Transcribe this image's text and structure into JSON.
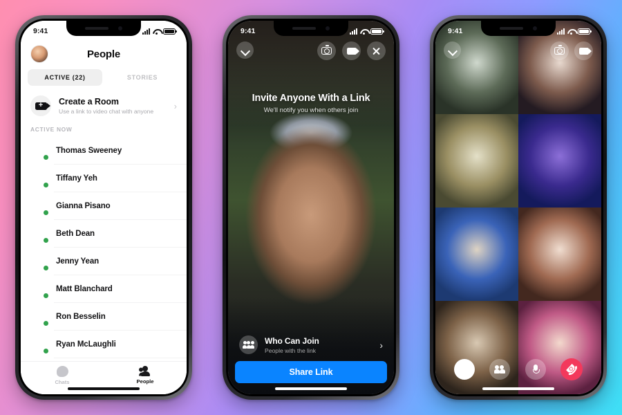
{
  "background": {
    "gradient_from": "#ff8fb0",
    "gradient_mid": "#a98cf5",
    "gradient_to": "#3ee0f5"
  },
  "phone1": {
    "status": {
      "time": "9:41",
      "signal_icon": "signal-bars-icon",
      "wifi_icon": "wifi-icon",
      "battery_icon": "battery-icon"
    },
    "header": {
      "title": "People",
      "avatar_icon": "profile-avatar"
    },
    "tabs": [
      {
        "label": "ACTIVE (22)",
        "active": true
      },
      {
        "label": "STORIES",
        "active": false
      }
    ],
    "create_room": {
      "title": "Create a Room",
      "subtitle": "Use a link to video chat with anyone",
      "icon": "add-video-room-icon",
      "chevron": "›"
    },
    "section_header": "ACTIVE NOW",
    "people": [
      {
        "name": "Thomas Sweeney",
        "online": true,
        "c1": "#8aa4c8",
        "c2": "#2c3f5c"
      },
      {
        "name": "Tiffany Yeh",
        "online": true,
        "c1": "#f3c43c",
        "c2": "#b07c1a"
      },
      {
        "name": "Gianna Pisano",
        "online": true,
        "c1": "#f0d7bb",
        "c2": "#b78a64"
      },
      {
        "name": "Beth Dean",
        "online": true,
        "c1": "#7e9b63",
        "c2": "#2f3a25"
      },
      {
        "name": "Jenny Yean",
        "online": true,
        "c1": "#e0a88a",
        "c2": "#8a4f3a"
      },
      {
        "name": "Matt Blanchard",
        "online": true,
        "c1": "#c3ccd8",
        "c2": "#3d5670"
      },
      {
        "name": "Ron Besselin",
        "online": true,
        "c1": "#79a6d8",
        "c2": "#26435f"
      },
      {
        "name": "Ryan McLaughli",
        "online": true,
        "c1": "#d7b27c",
        "c2": "#6d4f2e"
      }
    ],
    "tabbar": [
      {
        "label": "Chats",
        "icon": "chats-icon",
        "active": false
      },
      {
        "label": "People",
        "icon": "people-icon",
        "active": true
      }
    ]
  },
  "phone2": {
    "status": {
      "time": "9:41"
    },
    "top_controls": [
      {
        "name": "minimize-chevron-down-button",
        "icon": "chevron-down-icon"
      },
      {
        "name": "flip-camera-button",
        "icon": "camera-flip-icon"
      },
      {
        "name": "toggle-video-button",
        "icon": "video-camera-icon"
      },
      {
        "name": "close-call-button",
        "icon": "close-x-icon"
      }
    ],
    "invite": {
      "title": "Invite Anyone With a Link",
      "subtitle": "We'll notify you when others join"
    },
    "who_can_join": {
      "title": "Who Can Join",
      "subtitle": "People with the link",
      "icon": "group-people-icon",
      "chevron": "›"
    },
    "share_button": {
      "label": "Share Link",
      "color": "#0a84ff"
    }
  },
  "phone3": {
    "status": {
      "time": "9:41"
    },
    "top_controls": [
      {
        "name": "minimize-chevron-down-button",
        "icon": "chevron-down-icon"
      },
      {
        "name": "flip-camera-button",
        "icon": "camera-flip-icon"
      },
      {
        "name": "toggle-video-button",
        "icon": "video-camera-icon"
      }
    ],
    "participants": [
      {
        "slot": 1,
        "c1": "#cfd8cd",
        "c2": "#5d6b58",
        "c3": "#2a3328"
      },
      {
        "slot": 2,
        "c1": "#e8d9cf",
        "c2": "#7d5b4d",
        "c3": "#241b22"
      },
      {
        "slot": 3,
        "c1": "#e4e0c8",
        "c2": "#9a8f63",
        "c3": "#4a4a32"
      },
      {
        "slot": 4,
        "c1": "#8c6fd8",
        "c2": "#3a2a8e",
        "c3": "#141a5c"
      },
      {
        "slot": 5,
        "c1": "#ded3c3",
        "c2": "#3a63b8",
        "c3": "#1d3a72"
      },
      {
        "slot": 6,
        "c1": "#f0ddd0",
        "c2": "#a06a52",
        "c3": "#43281f"
      },
      {
        "slot": 7,
        "c1": "#d8c8b2",
        "c2": "#7d6248",
        "c3": "#2d241c"
      },
      {
        "slot": 8,
        "c1": "#f3d9cd",
        "c2": "#c05a86",
        "c3": "#5c2140"
      }
    ],
    "bottom_controls": [
      {
        "name": "effects-button",
        "icon": "effects-circle-icon"
      },
      {
        "name": "add-people-button",
        "icon": "add-people-icon"
      },
      {
        "name": "mute-microphone-button",
        "icon": "microphone-icon"
      },
      {
        "name": "end-call-button",
        "icon": "end-call-phone-icon",
        "color": "#f3395c"
      }
    ]
  }
}
